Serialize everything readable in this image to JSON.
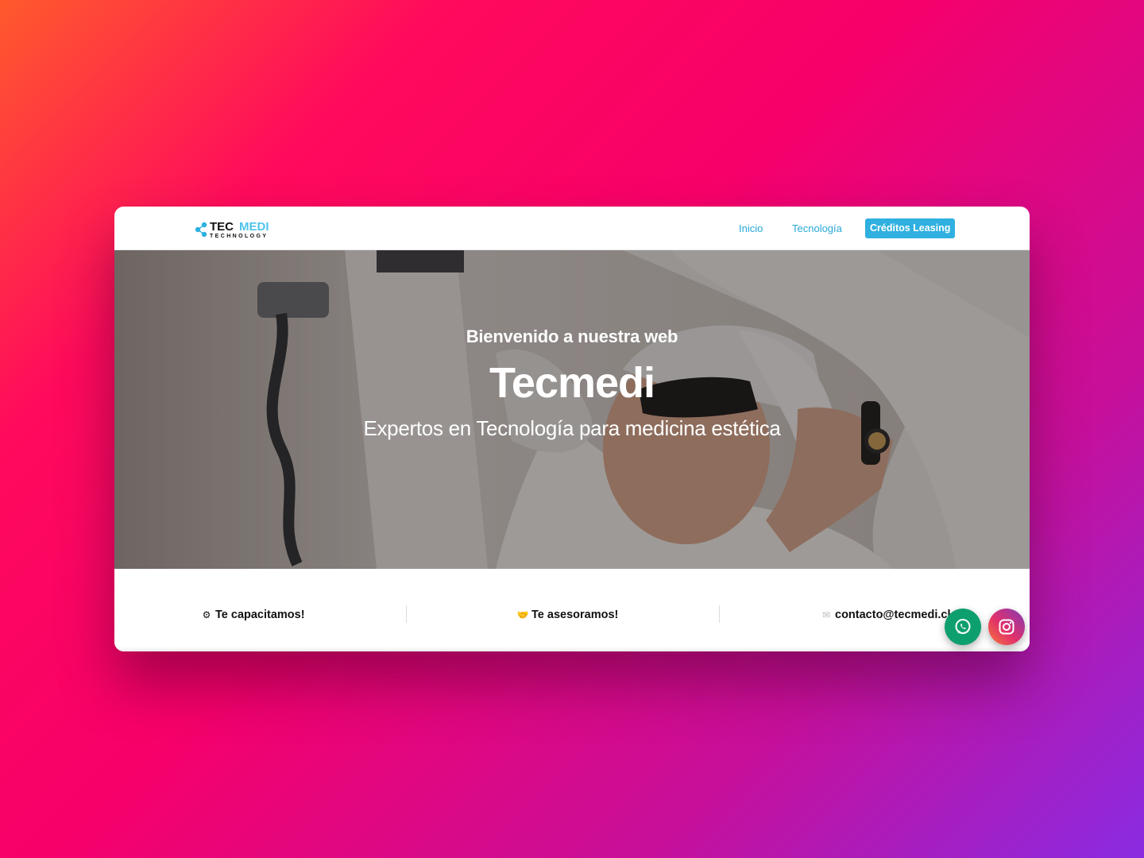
{
  "colors": {
    "accent": "#2fb0e0",
    "nav_link": "#27a8d6",
    "whatsapp": "#0e9f6e"
  },
  "header": {
    "logo": {
      "primary": "TEC",
      "secondary": "MEDI",
      "tagline": "TECHNOLOGY"
    },
    "nav": {
      "inicio": "Inicio",
      "tecnologia": "Tecnología",
      "cta": "Créditos Leasing"
    }
  },
  "hero": {
    "subtitle": "Bienvenido a nuestra web",
    "title": "Tecmedi",
    "tagline": "Expertos en Tecnología para medicina estética"
  },
  "features": [
    {
      "icon": "gear-icon",
      "glyph": "⚙",
      "label": "Te capacitamos!"
    },
    {
      "icon": "handshake-icon",
      "glyph": "🤝",
      "label": "Te asesoramos!"
    },
    {
      "icon": "envelope-icon",
      "glyph": "✉",
      "label": "contacto@tecmedi.cl"
    }
  ],
  "floating": {
    "whatsapp_icon": "whatsapp-icon",
    "instagram_icon": "instagram-icon"
  }
}
